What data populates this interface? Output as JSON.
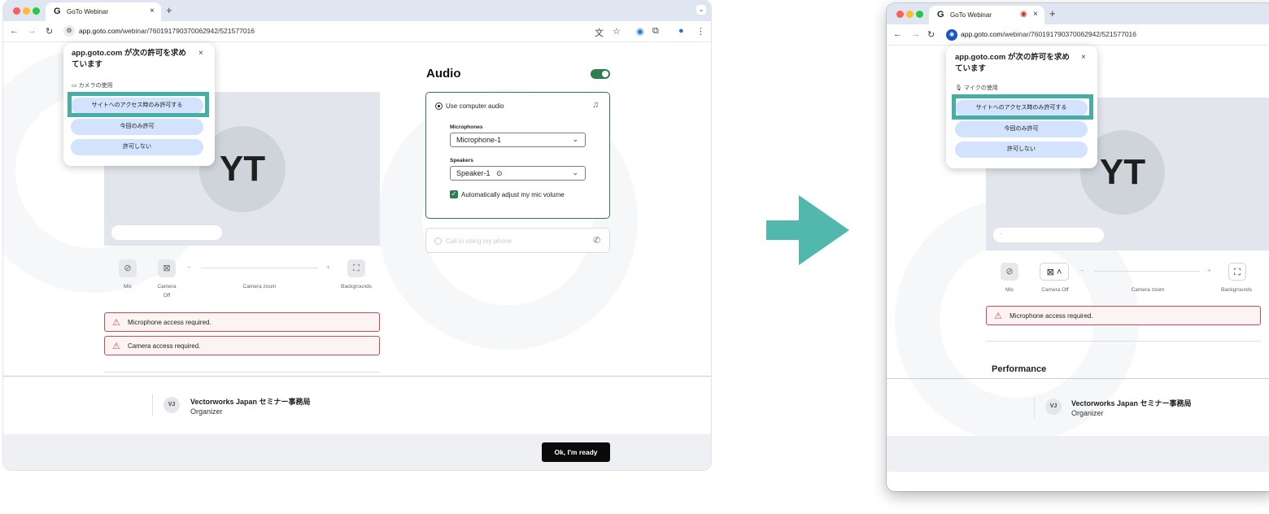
{
  "browser": {
    "tab_title": "GoTo Webinar",
    "tab_favicon": "G",
    "tab_close": "×",
    "new_tab": "+",
    "url_host": "app.goto.com",
    "url_path": "/webinar/7601917903700629​42/521577016"
  },
  "permission_popup": {
    "title_line1": "app.goto.com が次の許可を求め",
    "title_line2": "ています",
    "close": "×",
    "left_permission": "カメラの使用",
    "right_permission": "マイクの使用",
    "allow_while_visiting": "サイトへのアクセス時のみ許可する",
    "allow_this_time": "今回のみ許可",
    "never_allow": "許可しない"
  },
  "preview": {
    "initials": "YT",
    "name_placeholder": "."
  },
  "controls": {
    "mic": "Mic",
    "camera_left": "Camera\nOff",
    "camera_right": "Camera Off",
    "camera_zoom": "Camera zoom",
    "backgrounds": "Backgrounds",
    "minus": "−",
    "plus": "+"
  },
  "alerts": {
    "microphone": "Microphone access required.",
    "camera": "Camera access required."
  },
  "audio": {
    "title": "Audio",
    "use_computer_audio": "Use computer audio",
    "microphones_label": "Microphones",
    "microphone_value": "Microphone-1",
    "speakers_label": "Speakers",
    "speaker_value": "Speaker-1",
    "auto_adjust": "Automatically adjust my mic volume",
    "call_in": "Call in using my phone"
  },
  "performance_title": "Performance",
  "organizer": {
    "initials": "VJ",
    "name": "Vectorworks Japan セミナー事務局",
    "role": "Organizer"
  },
  "ready_button": "Ok, I'm ready",
  "colors": {
    "highlight": "#47aea6",
    "arrow": "#52b7ad",
    "accent_green": "#2e7d4f",
    "alert_red": "#d04a5e",
    "button_blue": "#d3e3fd"
  },
  "icons": [
    "chrome-dots",
    "back-icon",
    "forward-icon",
    "reload-icon",
    "site-info-icon",
    "translate-icon",
    "star-icon",
    "extension-icon",
    "profile-icon",
    "menu-icon",
    "camera-icon",
    "mic-icon",
    "mic-off-icon",
    "camera-off-icon",
    "background-icon",
    "warning-icon",
    "headset-icon",
    "phone-icon",
    "play-icon",
    "chevron-down-icon",
    "record-icon"
  ]
}
